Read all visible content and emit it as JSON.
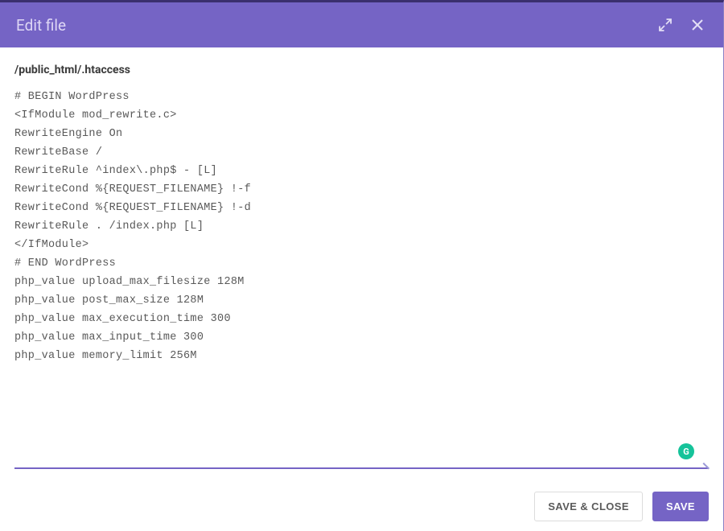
{
  "header": {
    "title": "Edit file"
  },
  "file": {
    "path": "/public_html/.htaccess",
    "content": "# BEGIN WordPress\n<IfModule mod_rewrite.c>\nRewriteEngine On\nRewriteBase /\nRewriteRule ^index\\.php$ - [L]\nRewriteCond %{REQUEST_FILENAME} !-f\nRewriteCond %{REQUEST_FILENAME} !-d\nRewriteRule . /index.php [L]\n</IfModule>\n# END WordPress\nphp_value upload_max_filesize 128M\nphp_value post_max_size 128M\nphp_value max_execution_time 300\nphp_value max_input_time 300\nphp_value memory_limit 256M"
  },
  "buttons": {
    "save_close": "SAVE & CLOSE",
    "save": "SAVE"
  },
  "icons": {
    "grammarly": "G"
  }
}
